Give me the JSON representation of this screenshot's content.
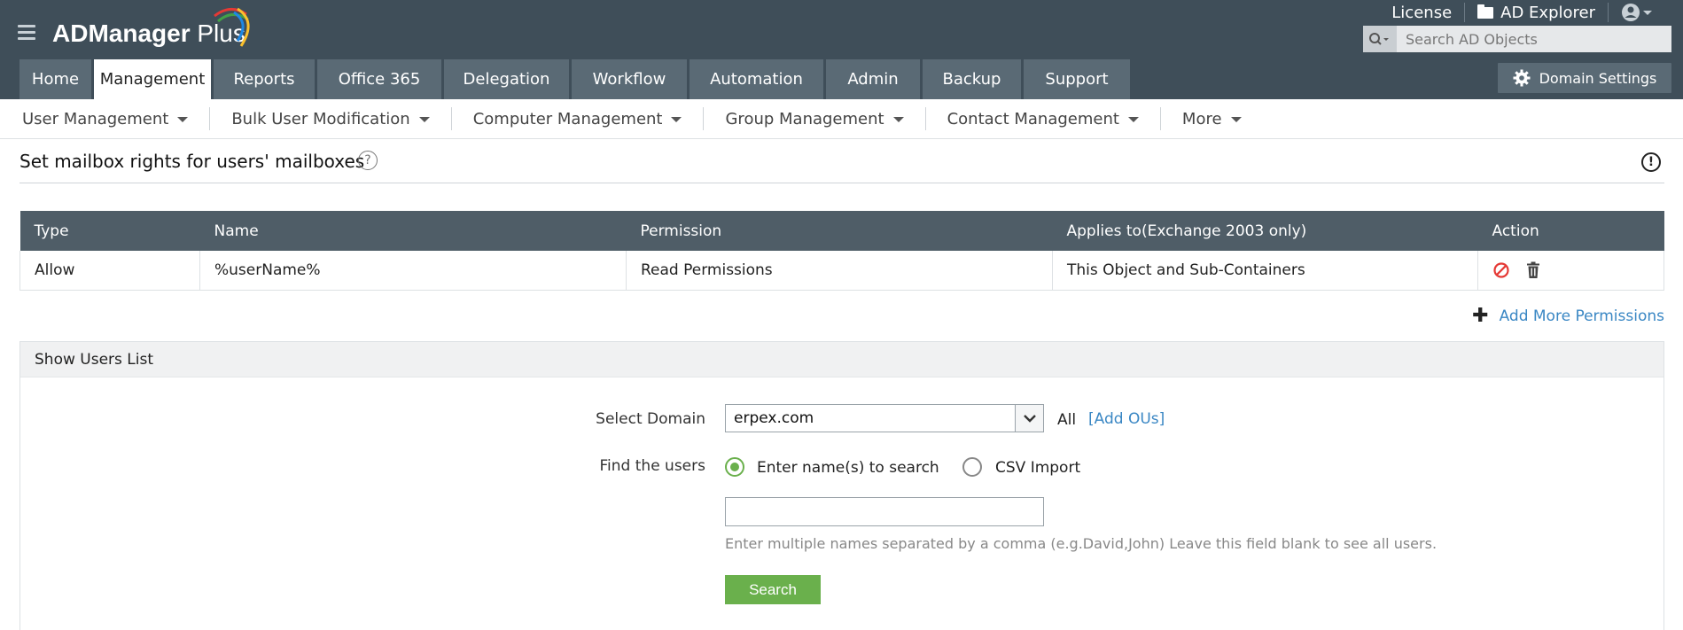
{
  "app": {
    "name_bold": "ADManager",
    "name_light": " Plus"
  },
  "toplinks": {
    "license": "License",
    "ad_explorer": "AD Explorer"
  },
  "search": {
    "placeholder": "Search AD Objects"
  },
  "tabs": [
    {
      "label": "Home"
    },
    {
      "label": "Management",
      "active": true
    },
    {
      "label": "Reports"
    },
    {
      "label": "Office 365"
    },
    {
      "label": "Delegation"
    },
    {
      "label": "Workflow"
    },
    {
      "label": "Automation"
    },
    {
      "label": "Admin"
    },
    {
      "label": "Backup"
    },
    {
      "label": "Support"
    }
  ],
  "domain_settings_label": "Domain Settings",
  "subnav": [
    {
      "label": "User Management"
    },
    {
      "label": "Bulk User Modification"
    },
    {
      "label": "Computer Management"
    },
    {
      "label": "Group Management"
    },
    {
      "label": "Contact Management"
    },
    {
      "label": "More"
    }
  ],
  "page": {
    "title": "Set mailbox rights for users' mailboxes",
    "help": "?",
    "info": "!"
  },
  "permissions_table": {
    "columns": [
      "Type",
      "Name",
      "Permission",
      "Applies to(Exchange 2003 only)",
      "Action"
    ],
    "rows": [
      {
        "type": "Allow",
        "name": "%userName%",
        "permission": "Read Permissions",
        "applies_to": "This Object and Sub-Containers"
      }
    ]
  },
  "add_more_permissions": "Add More Permissions",
  "users_panel": {
    "title": "Show Users List",
    "select_domain_label": "Select Domain",
    "domain_value": "erpex.com",
    "all_label": "All",
    "add_ous": "[Add OUs]",
    "find_users_label": "Find the users",
    "radio_names": "Enter name(s) to search",
    "radio_csv": "CSV Import",
    "names_value": "",
    "hint": "Enter multiple names separated by a comma (e.g.David,John) Leave this field blank to see all users.",
    "search_button": "Search"
  },
  "colors": {
    "header_bg": "#3f4e59",
    "tab_bg": "#5a6a75",
    "table_header_bg": "#4f5d67",
    "link": "#3a87c4",
    "accent_green": "#6ab04c",
    "delete_red": "#e53935"
  }
}
